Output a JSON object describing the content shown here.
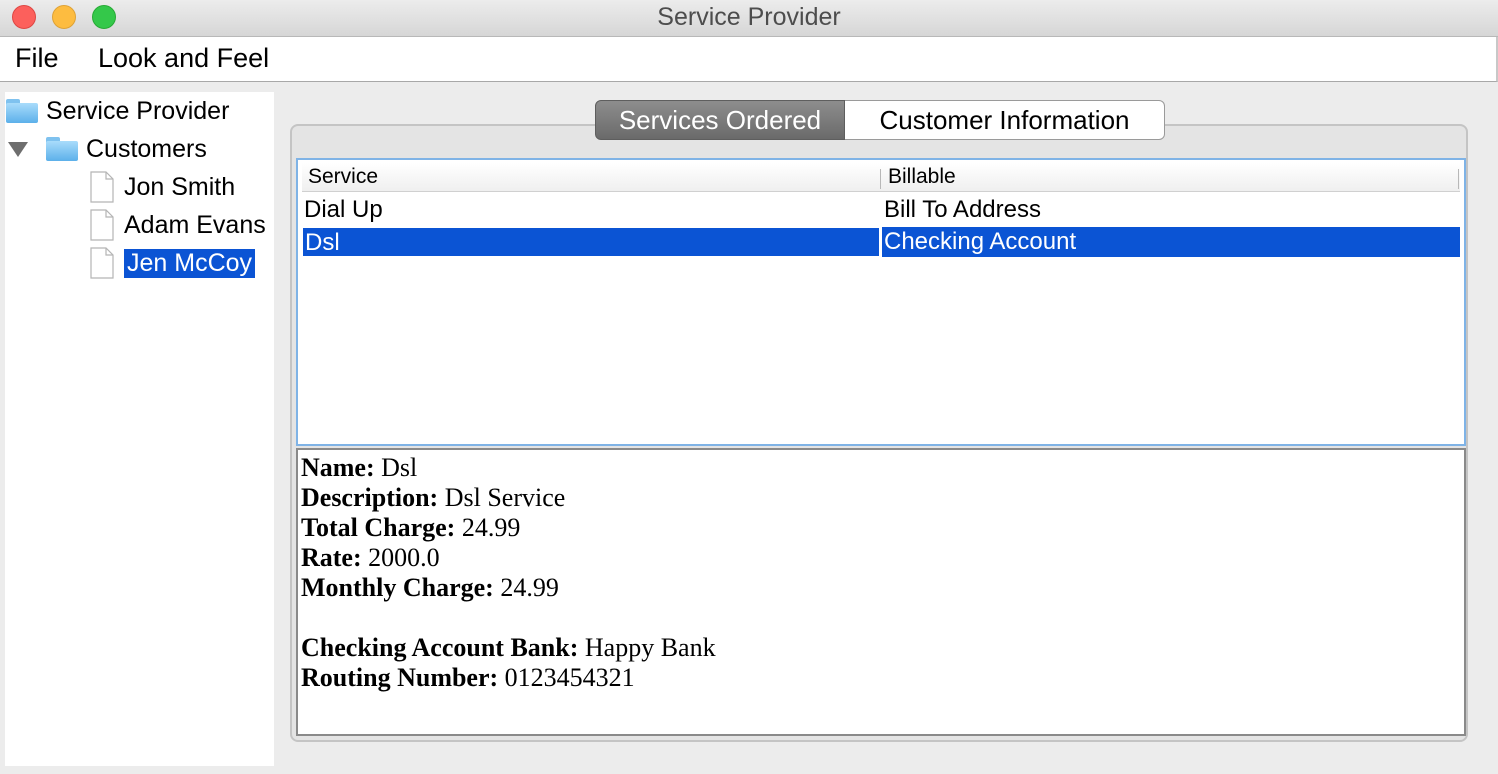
{
  "window": {
    "title": "Service Provider"
  },
  "menu": {
    "file": "File",
    "look_and_feel": "Look and Feel"
  },
  "tree": {
    "root": "Service Provider",
    "customers_label": "Customers",
    "customers": [
      "Jon Smith",
      "Adam Evans",
      "Jen McCoy"
    ],
    "selected_customer": "Jen McCoy"
  },
  "tabs": {
    "active": "Services Ordered",
    "inactive": "Customer Information"
  },
  "table": {
    "headers": [
      "Service",
      "Billable"
    ],
    "rows": [
      {
        "service": "Dial Up",
        "billable": "Bill To Address"
      },
      {
        "service": "Dsl",
        "billable": "Checking Account"
      }
    ],
    "selected_row": 1
  },
  "details": {
    "name_label": "Name:",
    "name_value": "Dsl",
    "description_label": "Description:",
    "description_value": "Dsl Service",
    "total_charge_label": "Total Charge:",
    "total_charge_value": "24.99",
    "rate_label": "Rate:",
    "rate_value": "2000.0",
    "monthly_charge_label": "Monthly Charge:",
    "monthly_charge_value": "24.99",
    "bank_label": "Checking Account Bank:",
    "bank_value": "Happy Bank",
    "routing_label": "Routing Number:",
    "routing_value": "0123454321"
  },
  "colors": {
    "selection": "#0b54d4",
    "close": "#fc605c",
    "minimize": "#fdbc40",
    "maximize": "#34c84a"
  }
}
